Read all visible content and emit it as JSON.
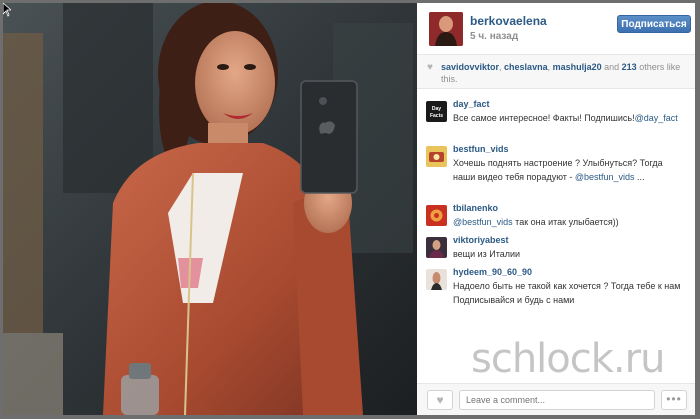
{
  "post": {
    "username": "berkovaelena",
    "timestamp": "5 ч. назад",
    "follow_label": "Подписаться"
  },
  "likes": {
    "names": [
      "savidovviktor",
      "cheslavna",
      "mashulja20"
    ],
    "sep1": ", ",
    "sep2": ", ",
    "and_text": " and ",
    "count": "213",
    "tail": " others like this."
  },
  "comments": [
    {
      "user": "day_fact",
      "text": "Все самое интересное! Факты! Подпишись!",
      "mention": "@day_fact",
      "after": "",
      "avatar_label": "Day Facts"
    },
    {
      "user": "bestfun_vids",
      "text": "Хочешь поднять настроение ? Улыбнуться?  Тогда наши видео тебя порадуют - ",
      "mention": "@bestfun_vids",
      "after": " ...",
      "avatar_label": ""
    },
    {
      "user": "tbilanenko",
      "text": "",
      "mention": "@bestfun_vids",
      "after": " так она итак улыбается))",
      "avatar_label": ""
    },
    {
      "user": "viktoriyabest",
      "text": "вещи из Италии",
      "mention": "",
      "after": "",
      "avatar_label": ""
    },
    {
      "user": "hydeem_90_60_90",
      "text": "Надоело быть не такой как хочется ? Тогда тебе к нам     Подписывайся и будь с нами  ",
      "mention": "",
      "after": "",
      "avatar_label": ""
    }
  ],
  "footer": {
    "comment_placeholder": "Leave a comment...",
    "more_label": "•••"
  },
  "watermark": "schlock.ru",
  "colors": {
    "link": "#2c5a85",
    "follow_button": "#3d70b0",
    "jacket": "#b9553a"
  }
}
